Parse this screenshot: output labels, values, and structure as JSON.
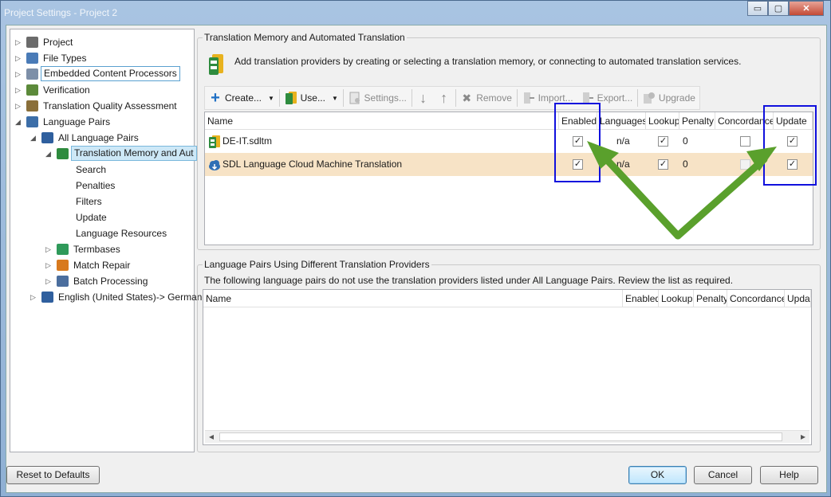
{
  "window": {
    "title": "Project Settings - Project 2"
  },
  "titlebar_buttons": {
    "minimize": "▭",
    "maximize": "▢",
    "close": "✕"
  },
  "tree": [
    {
      "label": "Project",
      "level": 0,
      "icon": "project-icon",
      "expander": "▷"
    },
    {
      "label": "File Types",
      "level": 0,
      "icon": "file-types-icon",
      "expander": "▷"
    },
    {
      "label": "Embedded Content Processors",
      "level": 0,
      "icon": "embedded-content-icon",
      "expander": "▷"
    },
    {
      "label": "Verification",
      "level": 0,
      "icon": "verification-icon",
      "expander": "▷"
    },
    {
      "label": "Translation Quality Assessment",
      "level": 0,
      "icon": "tqa-icon",
      "expander": "▷"
    },
    {
      "label": "Language Pairs",
      "level": 0,
      "icon": "language-pairs-icon",
      "expander": "◢"
    },
    {
      "label": "All Language Pairs",
      "level": 1,
      "icon": "flag-icon",
      "expander": "◢"
    },
    {
      "label": "Translation Memory and Aut",
      "level": 2,
      "icon": "tm-icon",
      "expander": "◢"
    },
    {
      "label": "Search",
      "level": 3,
      "icon": "",
      "expander": ""
    },
    {
      "label": "Penalties",
      "level": 3,
      "icon": "",
      "expander": ""
    },
    {
      "label": "Filters",
      "level": 3,
      "icon": "",
      "expander": ""
    },
    {
      "label": "Update",
      "level": 3,
      "icon": "",
      "expander": ""
    },
    {
      "label": "Language Resources",
      "level": 3,
      "icon": "",
      "expander": ""
    },
    {
      "label": "Termbases",
      "level": 2,
      "icon": "termbase-icon",
      "expander": "▷"
    },
    {
      "label": "Match Repair",
      "level": 2,
      "icon": "wrench-icon",
      "expander": "▷"
    },
    {
      "label": "Batch Processing",
      "level": 2,
      "icon": "batch-icon",
      "expander": "▷"
    },
    {
      "label": "English (United States)-> German",
      "level": 1,
      "icon": "flag-icon",
      "expander": "▷"
    }
  ],
  "tm_group": {
    "title": "Translation Memory and Automated Translation",
    "info": "Add translation providers by creating or selecting a translation memory, or connecting to automated translation services."
  },
  "toolbar": {
    "create": "Create...",
    "use": "Use...",
    "settings": "Settings...",
    "remove": "Remove",
    "import": "Import...",
    "export": "Export...",
    "upgrade": "Upgrade",
    "dropdown_arrow": "▼",
    "down_arrow": "↓",
    "up_arrow": "↑",
    "remove_x": "✖",
    "plus": "+"
  },
  "tm_grid": {
    "columns": [
      "Name",
      "Enabled",
      "Languages",
      "Lookup",
      "Penalty",
      "Concordance",
      "Update"
    ],
    "rows": [
      {
        "name": "DE-IT.sdltm",
        "enabled": true,
        "languages": "n/a",
        "lookup": true,
        "penalty": "0",
        "concordance": false,
        "update": true,
        "check": "✓"
      },
      {
        "name": "SDL Language Cloud Machine Translation",
        "enabled": true,
        "languages": "n/a",
        "lookup": true,
        "penalty": "0",
        "concordance": false,
        "update": true,
        "check": "✓"
      }
    ]
  },
  "lp_group": {
    "title": "Language Pairs Using Different Translation Providers",
    "info": "The following language pairs do not use the translation providers listed under All Language Pairs. Review the list as required.",
    "columns": [
      "Name",
      "Enabled",
      "Lookup",
      "Penalty",
      "Concordance",
      "Upda"
    ],
    "scroll_left": "◂",
    "scroll_right": "▸"
  },
  "buttons": {
    "reset": "Reset to Defaults",
    "ok": "OK",
    "cancel": "Cancel",
    "help": "Help"
  },
  "colors": {
    "highlight_box": "#1010dd",
    "arrow": "#5aa02c",
    "selected_row": "#f7e3c6"
  }
}
